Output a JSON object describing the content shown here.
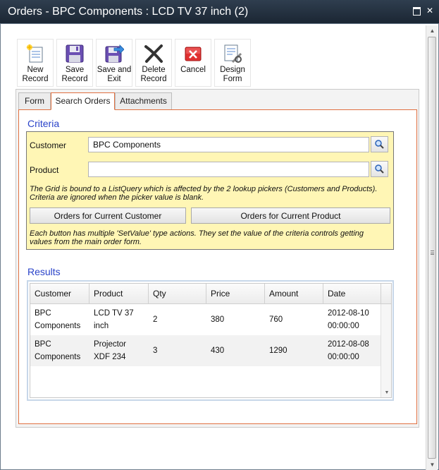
{
  "window": {
    "title": "Orders - BPC Components : LCD TV 37 inch (2)",
    "maximize_icon": "maximize-icon",
    "close_icon": "close-icon",
    "close_glyph": "✕"
  },
  "toolbar": {
    "buttons": [
      {
        "id": "new-record",
        "label": "New\nRecord",
        "icon": "new-record-icon"
      },
      {
        "id": "save-record",
        "label": "Save\nRecord",
        "icon": "floppy-disk-icon"
      },
      {
        "id": "save-and-exit",
        "label": "Save and\nExit",
        "icon": "save-exit-icon"
      },
      {
        "id": "delete-record",
        "label": "Delete\nRecord",
        "icon": "delete-x-icon"
      },
      {
        "id": "cancel",
        "label": "Cancel",
        "icon": "cancel-icon"
      },
      {
        "id": "design-form",
        "label": "Design\nForm",
        "icon": "design-form-icon"
      }
    ]
  },
  "tabs": [
    {
      "label": "Form",
      "active": false
    },
    {
      "label": "Search Orders",
      "active": true
    },
    {
      "label": "Attachments",
      "active": false
    }
  ],
  "criteria": {
    "title": "Criteria",
    "customer_label": "Customer",
    "customer_value": "BPC Components",
    "product_label": "Product",
    "product_value": "",
    "note1": "The Grid is bound to a ListQuery which is affected by the 2 lookup pickers (Customers and Products). Criteria are ignored when the picker value is blank.",
    "btn_customer": "Orders for Current Customer",
    "btn_product": "Orders for Current Product",
    "note2": "Each button has multiple 'SetValue' type actions. They set the value of the criteria controls getting values from the main order form."
  },
  "results": {
    "title": "Results",
    "columns": [
      "Customer",
      "Product",
      "Qty",
      "Price",
      "Amount",
      "Date"
    ],
    "rows": [
      [
        "BPC Components",
        "LCD TV 37 inch",
        "2",
        "380",
        "760",
        "2012-08-10 00:00:00"
      ],
      [
        "BPC Components",
        "Projector XDF 234",
        "3",
        "430",
        "1290",
        "2012-08-08 00:00:00"
      ]
    ]
  },
  "colors": {
    "accent_orange": "#e07040",
    "section_blue": "#2a43c9",
    "criteria_bg": "#fff6b5",
    "titlebar": "#1b2633"
  }
}
